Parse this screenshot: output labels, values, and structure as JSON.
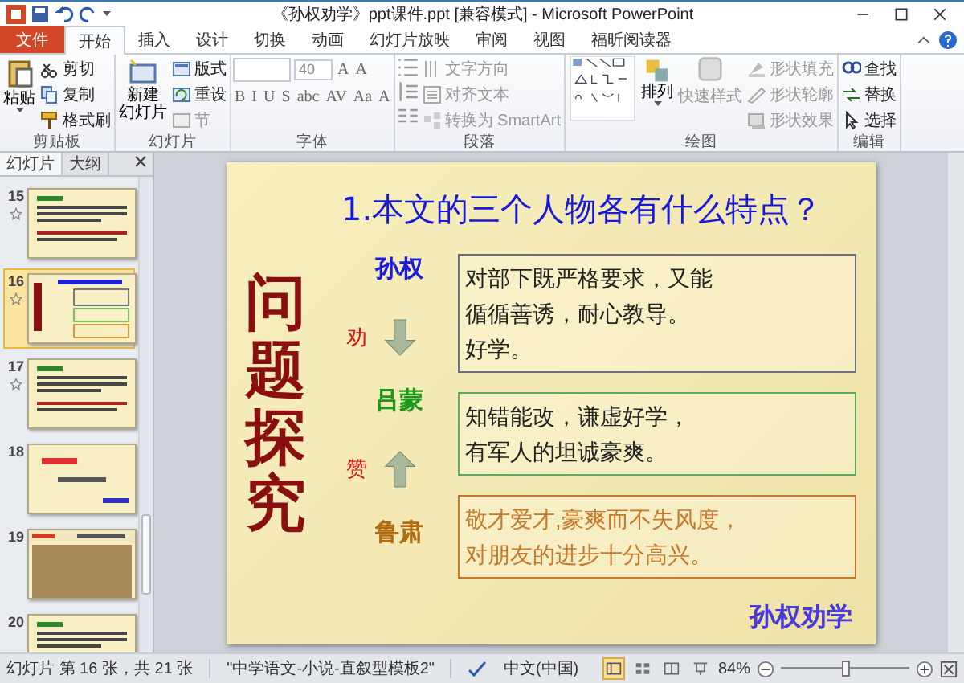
{
  "window": {
    "title": "《孙权劝学》ppt课件.ppt [兼容模式] - Microsoft PowerPoint"
  },
  "ribbon_tabs": [
    {
      "label": "文件",
      "kind": "file",
      "selected": false
    },
    {
      "label": "开始",
      "kind": "tab",
      "selected": true
    },
    {
      "label": "插入",
      "kind": "tab",
      "selected": false
    },
    {
      "label": "设计",
      "kind": "tab",
      "selected": false
    },
    {
      "label": "切换",
      "kind": "tab",
      "selected": false
    },
    {
      "label": "动画",
      "kind": "tab",
      "selected": false
    },
    {
      "label": "幻灯片放映",
      "kind": "tab",
      "selected": false
    },
    {
      "label": "审阅",
      "kind": "tab",
      "selected": false
    },
    {
      "label": "视图",
      "kind": "tab",
      "selected": false
    },
    {
      "label": "福昕阅读器",
      "kind": "tab",
      "selected": false
    }
  ],
  "ribbon_groups": [
    {
      "kind": "clipboard",
      "label": "剪贴板",
      "big": "粘贴",
      "commands": [
        {
          "label": "剪切",
          "disabled": false
        },
        {
          "label": "复制",
          "disabled": false
        },
        {
          "label": "格式刷",
          "disabled": false
        }
      ]
    },
    {
      "kind": "slides",
      "label": "幻灯片",
      "big_lines": [
        "新建",
        "幻灯片"
      ],
      "commands": [
        {
          "label": "版式",
          "disabled": false
        },
        {
          "label": "重设",
          "disabled": false
        },
        {
          "label": "节",
          "disabled": true
        }
      ]
    },
    {
      "kind": "font",
      "label": "字体",
      "size": "40",
      "size_buttons": [
        "A",
        "A"
      ],
      "format_buttons": [
        "B",
        "I",
        "U",
        "S",
        "abc",
        "AV",
        "Aa",
        "A"
      ]
    },
    {
      "kind": "paragraph",
      "label": "段落",
      "commands": [
        {
          "label": "文字方向",
          "disabled": true
        },
        {
          "label": "对齐文本",
          "disabled": true
        },
        {
          "label": "转换为 SmartArt",
          "disabled": true
        }
      ]
    },
    {
      "kind": "drawing",
      "label": "绘图",
      "arrange": "排列",
      "quick_styles": "快速样式",
      "commands": [
        {
          "label": "形状填充",
          "disabled": true
        },
        {
          "label": "形状轮廓",
          "disabled": true
        },
        {
          "label": "形状效果",
          "disabled": true
        }
      ]
    },
    {
      "kind": "editing",
      "label": "编辑",
      "commands": [
        {
          "label": "查找",
          "disabled": false
        },
        {
          "label": "替换",
          "disabled": false
        },
        {
          "label": "选择",
          "disabled": false
        }
      ]
    }
  ],
  "pane_tabs": [
    {
      "label": "幻灯片",
      "selected": true
    },
    {
      "label": "大纲",
      "selected": false
    }
  ],
  "thumbnails": [
    {
      "number": "15",
      "kind": "text",
      "animated": true,
      "selected": false
    },
    {
      "number": "16",
      "kind": "current",
      "animated": true,
      "selected": true
    },
    {
      "number": "17",
      "kind": "text",
      "animated": true,
      "selected": false
    },
    {
      "number": "18",
      "kind": "title",
      "animated": false,
      "selected": false
    },
    {
      "number": "19",
      "kind": "picture",
      "animated": false,
      "selected": false
    },
    {
      "number": "20",
      "kind": "text",
      "animated": false,
      "selected": false
    }
  ],
  "slide": {
    "side_title": "问题探究",
    "heading": "1.本文的三个人物各有什么特点？",
    "people": [
      {
        "name": "孙权",
        "color": "#1c1ce0"
      },
      {
        "name": "吕蒙",
        "color": "#1a9a1a"
      },
      {
        "name": "鲁肃",
        "color": "#b06a10"
      }
    ],
    "links": [
      {
        "verb": "劝",
        "kind": "down"
      },
      {
        "verb": "赞",
        "kind": "up"
      }
    ],
    "boxes": [
      {
        "color": "#6e6e80",
        "lines": [
          "对部下既严格要求，又能",
          "循循善诱，耐心教导。",
          "好学。"
        ]
      },
      {
        "color": "#5cae5c",
        "lines": [
          "知错能改，谦虚好学，",
          "有军人的坦诚豪爽。"
        ]
      },
      {
        "color": "#c8782a",
        "lines": [
          "敬才爱才,豪爽而不失风度，",
          "对朋友的进步十分高兴。"
        ]
      }
    ],
    "footer": "孙权劝学"
  },
  "status_bar": {
    "slide_info": "幻灯片 第 16 张，共 21 张",
    "theme": "\"中学语文-小说-直叙型模板2\"",
    "language": "中文(中国)",
    "views": [
      {
        "kind": "normal",
        "selected": true
      },
      {
        "kind": "sorter",
        "selected": false
      },
      {
        "kind": "reading",
        "selected": false
      },
      {
        "kind": "show",
        "selected": false
      }
    ],
    "zoom": "84%",
    "zoom_slider": {
      "level": 0.5
    }
  }
}
